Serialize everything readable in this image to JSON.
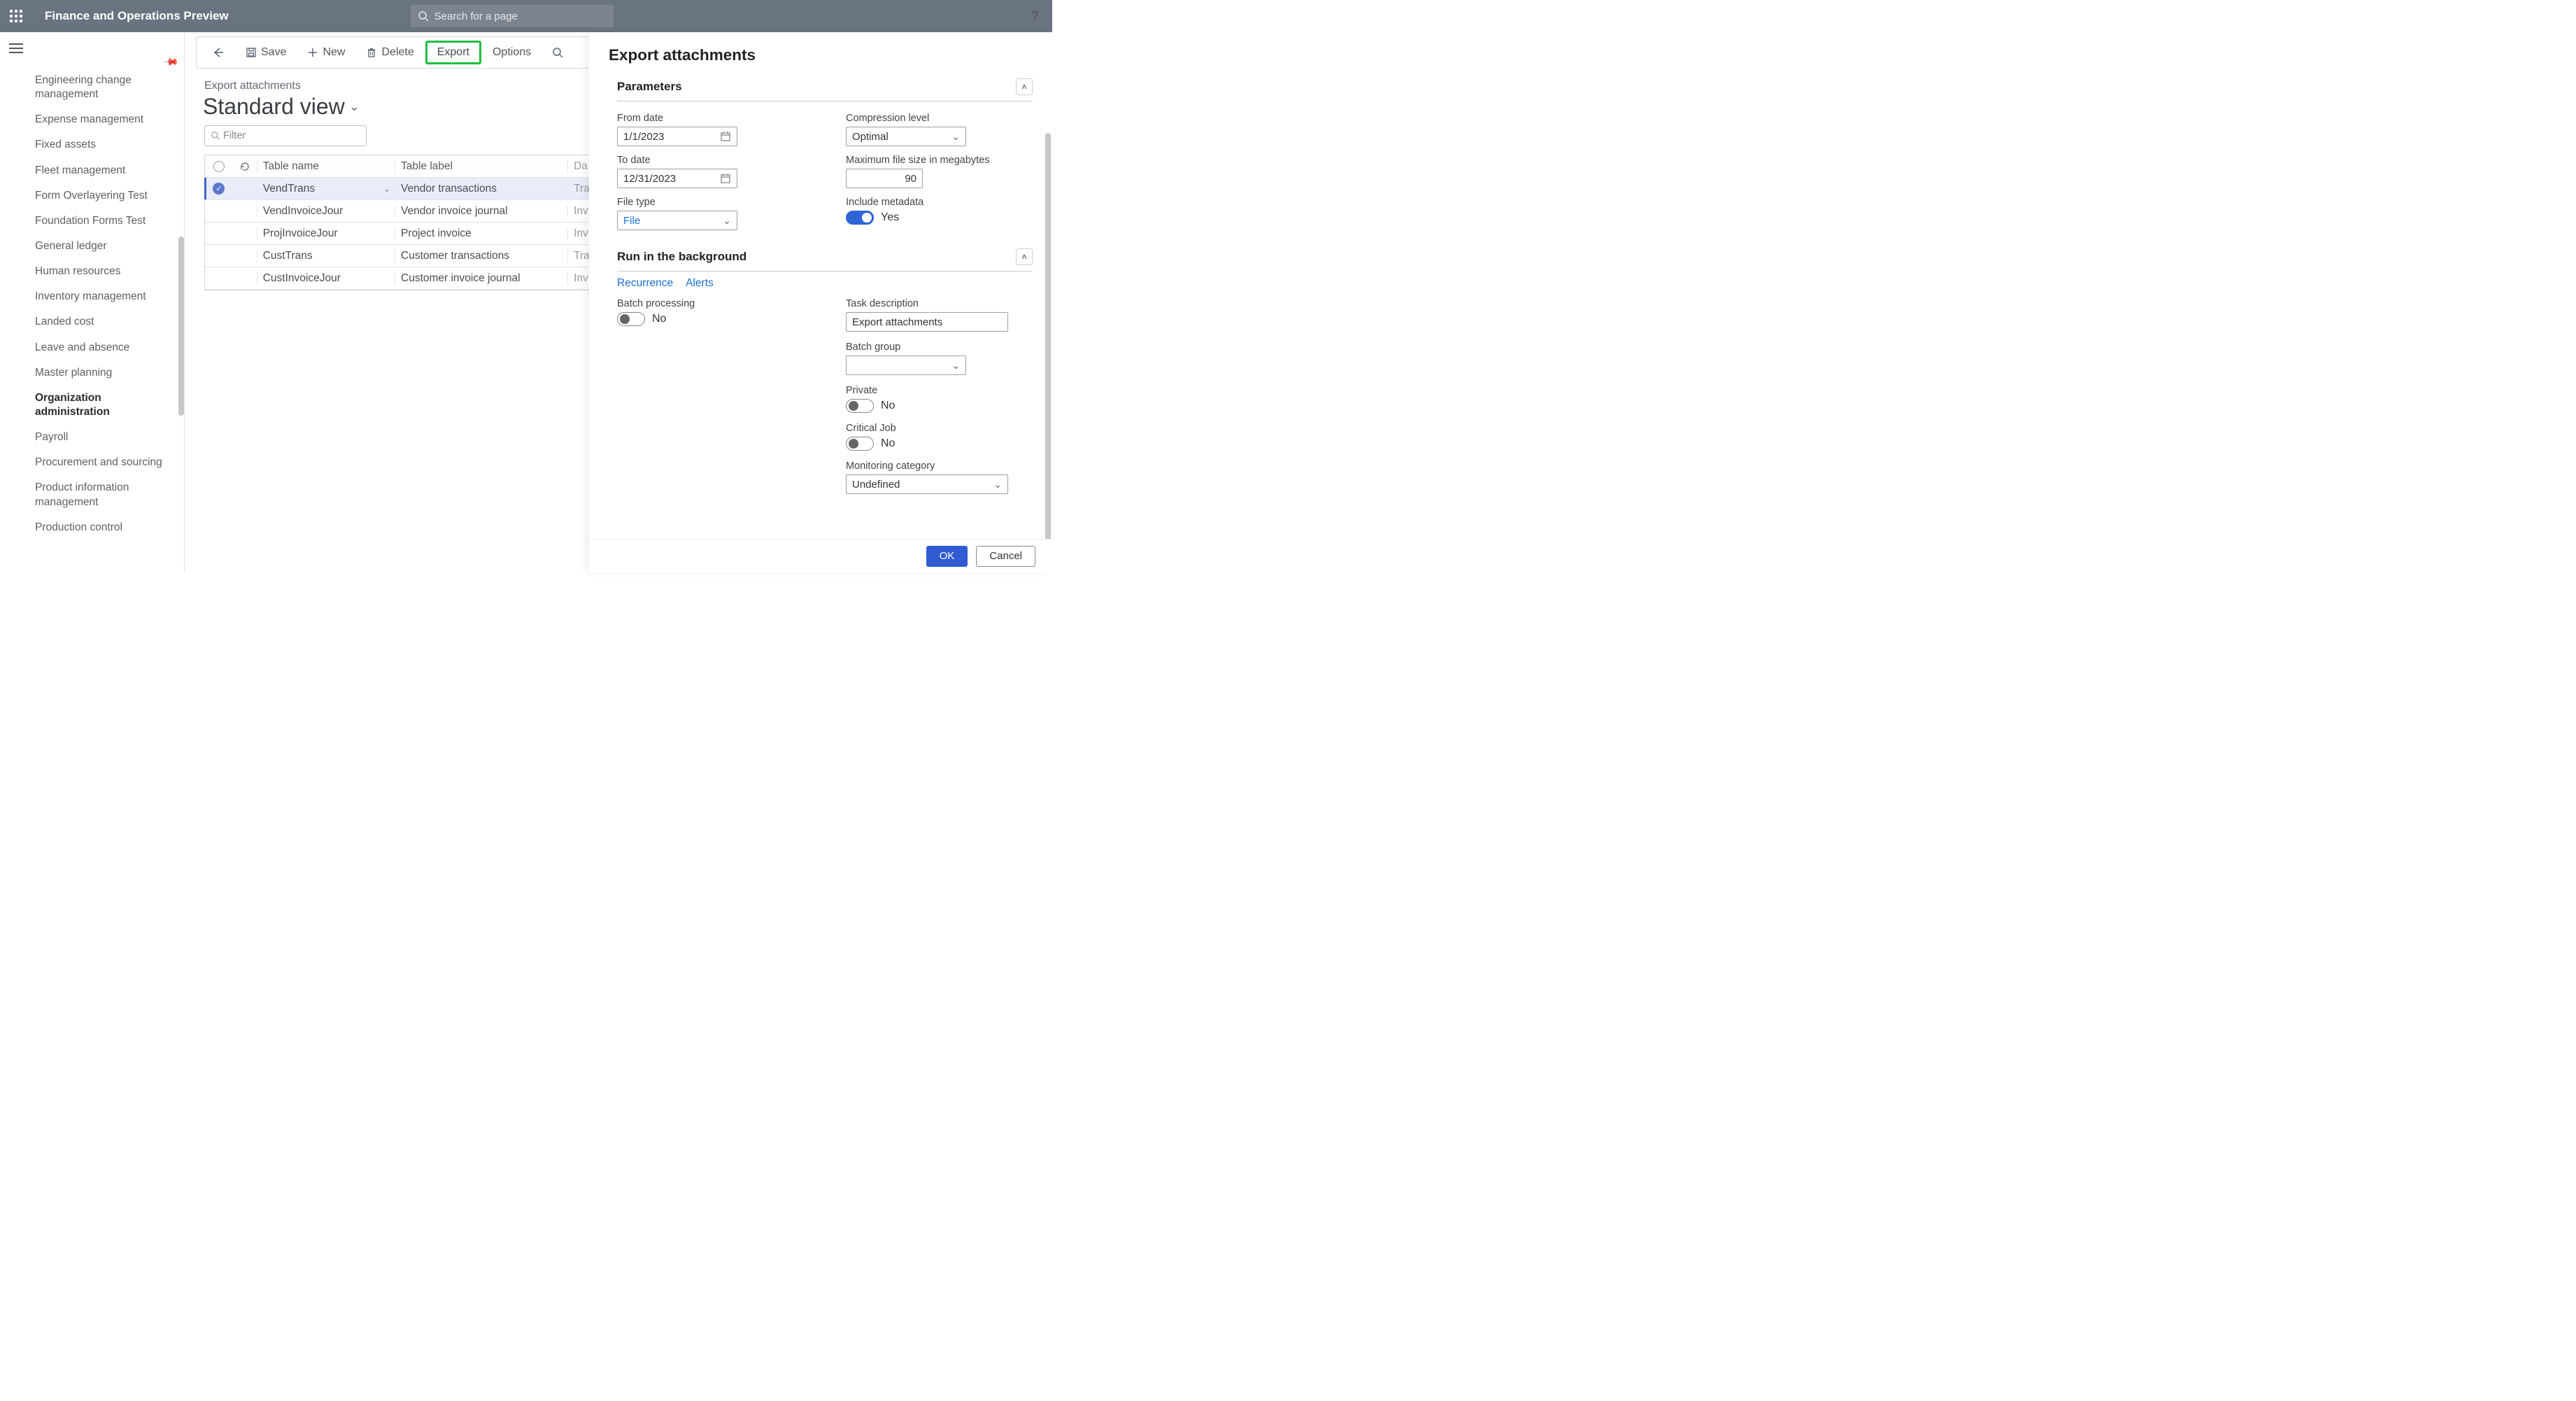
{
  "header": {
    "app_title": "Finance and Operations Preview",
    "search_placeholder": "Search for a page"
  },
  "sidebar": {
    "items": [
      {
        "label": "Engineering change management"
      },
      {
        "label": "Expense management"
      },
      {
        "label": "Fixed assets"
      },
      {
        "label": "Fleet management"
      },
      {
        "label": "Form Overlayering Test"
      },
      {
        "label": "Foundation Forms Test"
      },
      {
        "label": "General ledger"
      },
      {
        "label": "Human resources"
      },
      {
        "label": "Inventory management"
      },
      {
        "label": "Landed cost"
      },
      {
        "label": "Leave and absence"
      },
      {
        "label": "Master planning"
      },
      {
        "label": "Organization administration",
        "active": true
      },
      {
        "label": "Payroll"
      },
      {
        "label": "Procurement and sourcing"
      },
      {
        "label": "Product information management"
      },
      {
        "label": "Production control"
      }
    ]
  },
  "actionbar": {
    "save": "Save",
    "new": "New",
    "delete": "Delete",
    "export": "Export",
    "options": "Options"
  },
  "page": {
    "crumb": "Export attachments",
    "view_title": "Standard view",
    "filter_placeholder": "Filter"
  },
  "grid": {
    "columns": {
      "table_name": "Table name",
      "table_label": "Table label",
      "data_col": "Da"
    },
    "rows": [
      {
        "table_name": "VendTrans",
        "table_label": "Vendor transactions",
        "trail": "Tra",
        "selected": true
      },
      {
        "table_name": "VendInvoiceJour",
        "table_label": "Vendor invoice journal",
        "trail": "Inv"
      },
      {
        "table_name": "ProjInvoiceJour",
        "table_label": "Project invoice",
        "trail": "Inv"
      },
      {
        "table_name": "CustTrans",
        "table_label": "Customer transactions",
        "trail": "Tra"
      },
      {
        "table_name": "CustInvoiceJour",
        "table_label": "Customer invoice journal",
        "trail": "Inv"
      }
    ]
  },
  "panel": {
    "title": "Export attachments",
    "parameters": {
      "heading": "Parameters",
      "from_date_label": "From date",
      "from_date_value": "1/1/2023",
      "to_date_label": "To date",
      "to_date_value": "12/31/2023",
      "file_type_label": "File type",
      "file_type_value": "File",
      "compression_label": "Compression level",
      "compression_value": "Optimal",
      "max_file_label": "Maximum file size in megabytes",
      "max_file_value": "90",
      "include_meta_label": "Include metadata",
      "include_meta_value": "Yes"
    },
    "background": {
      "heading": "Run in the background",
      "recurrence": "Recurrence",
      "alerts": "Alerts",
      "batch_processing_label": "Batch processing",
      "batch_processing_value": "No",
      "task_desc_label": "Task description",
      "task_desc_value": "Export attachments",
      "batch_group_label": "Batch group",
      "batch_group_value": "",
      "private_label": "Private",
      "private_value": "No",
      "critical_label": "Critical Job",
      "critical_value": "No",
      "monitoring_label": "Monitoring category",
      "monitoring_value": "Undefined"
    },
    "footer": {
      "ok": "OK",
      "cancel": "Cancel"
    }
  }
}
